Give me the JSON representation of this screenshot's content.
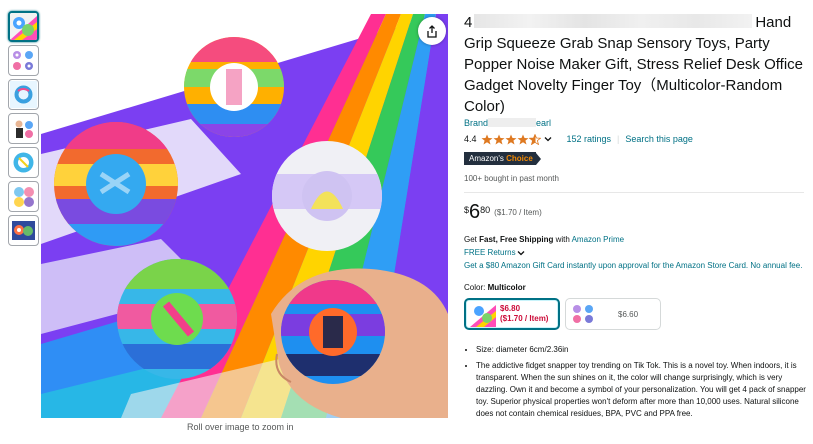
{
  "gallery": {
    "thumbnails": [
      "thumb-1",
      "thumb-2",
      "thumb-3",
      "thumb-4",
      "thumb-5",
      "thumb-6",
      "thumb-7"
    ],
    "zoom_hint": "Roll over image to zoom in"
  },
  "product": {
    "title_start": "4",
    "title_rest": "Hand Grip Squeeze Grab Snap Sensory Toys, Party Popper Noise Maker Gift, Stress Relief Desk Office Gadget Novelty Finger Toy（Multicolor-Random Color)",
    "brand_prefix": "Brand",
    "brand_suffix": "earl",
    "rating": "4.4",
    "ratings_count": "152 ratings",
    "search_page": "Search this page",
    "badge_prefix": "Amazon's",
    "badge_choice": "Choice",
    "bought": "100+ bought in past month",
    "price_symbol": "$",
    "price_whole": "6",
    "price_fraction": "80",
    "price_unit": "($1.70 / Item)",
    "shipping_prefix": "Get ",
    "shipping_bold": "Fast, Free Shipping",
    "shipping_with": " with ",
    "shipping_prime": "Amazon Prime",
    "returns": "FREE Returns",
    "gift_card": "Get a $80 Amazon Gift Card instantly upon approval for the Amazon Store Card. No annual fee.",
    "color_label": "Color: ",
    "color_value": "Multicolor",
    "variants": [
      {
        "price": "$6.80",
        "unit": "($1.70 / Item)"
      },
      {
        "price": "$6.60"
      }
    ],
    "bullets": [
      "Size: diameter 6cm/2.36in",
      "The addictive fidget snapper toy trending on Tik Tok. This is a novel toy. When indoors, it is transparent. When the sun shines on it, the color will change surprisingly, which is very dazzling. Own it and become a symbol of your personalization. You will get 4 pack of snapper toy. Superior physical properties won't deform after more than 10,000 uses. Natural silicone does not contain chemical residues, BPA, PVC and PPA free."
    ]
  },
  "colors": {
    "link": "#007185",
    "star": "#de7921",
    "price_red": "#cc0c39",
    "badge_bg": "#232f3e",
    "badge_orange": "#f08804"
  }
}
